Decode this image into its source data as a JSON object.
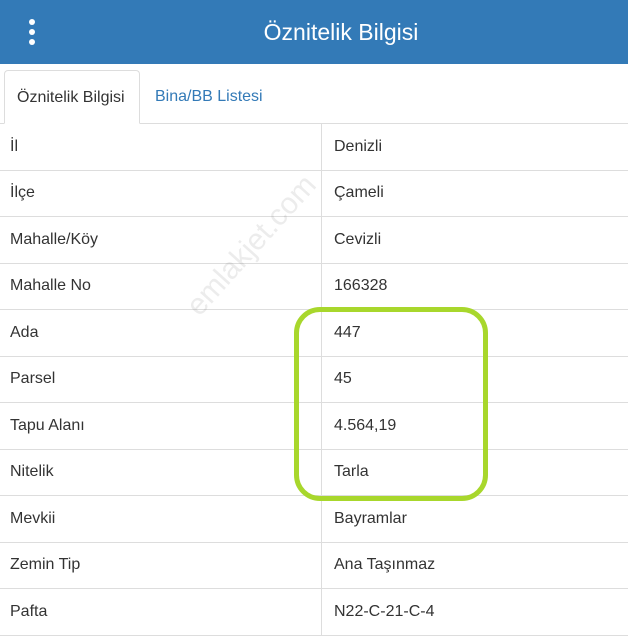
{
  "header": {
    "title": "Öznitelik Bilgisi"
  },
  "tabs": [
    {
      "label": "Öznitelik Bilgisi",
      "active": true
    },
    {
      "label": "Bina/BB Listesi",
      "active": false
    }
  ],
  "rows": [
    {
      "label": "İl",
      "value": "Denizli"
    },
    {
      "label": "İlçe",
      "value": "Çameli"
    },
    {
      "label": "Mahalle/Köy",
      "value": "Cevizli"
    },
    {
      "label": "Mahalle No",
      "value": "166328"
    },
    {
      "label": "Ada",
      "value": "447"
    },
    {
      "label": "Parsel",
      "value": "45"
    },
    {
      "label": "Tapu Alanı",
      "value": "4.564,19"
    },
    {
      "label": "Nitelik",
      "value": "Tarla"
    },
    {
      "label": "Mevkii",
      "value": "Bayramlar"
    },
    {
      "label": "Zemin Tip",
      "value": "Ana Taşınmaz"
    },
    {
      "label": "Pafta",
      "value": "N22-C-21-C-4"
    }
  ],
  "watermark": "emlakjet.com",
  "colors": {
    "header": "#337ab7",
    "highlight": "#a8d72c",
    "tab_link": "#337ab7"
  }
}
